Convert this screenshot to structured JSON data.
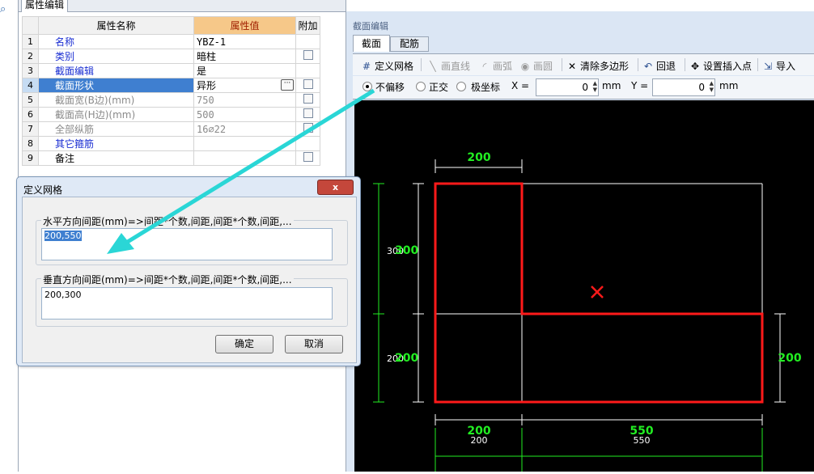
{
  "property_panel": {
    "tab": "属性编辑",
    "headers": {
      "name": "属性名称",
      "value": "属性值",
      "extra": "附加"
    },
    "rows": [
      {
        "idx": "1",
        "name": "名称",
        "value": "YBZ-1"
      },
      {
        "idx": "2",
        "name": "类别",
        "value": "暗柱"
      },
      {
        "idx": "3",
        "name": "截面编辑",
        "value": "是"
      },
      {
        "idx": "4",
        "name": "截面形状",
        "value": "异形",
        "button": "···"
      },
      {
        "idx": "5",
        "name": "截面宽(B边)(mm)",
        "value": "750"
      },
      {
        "idx": "6",
        "name": "截面高(H边)(mm)",
        "value": "500"
      },
      {
        "idx": "7",
        "name": "全部纵筋",
        "value": "16⌀22"
      },
      {
        "idx": "8",
        "name": "其它箍筋",
        "value": ""
      },
      {
        "idx": "9",
        "name": "备注",
        "value": ""
      }
    ]
  },
  "section_editor": {
    "title": "截面编辑",
    "tabs": [
      "截面",
      "配筋"
    ],
    "toolbar": {
      "define_grid": "定义网格",
      "draw_line": "画直线",
      "draw_arc": "画弧",
      "draw_circle": "画圆",
      "clear_polygon": "清除多边形",
      "undo": "回退",
      "set_insert_point": "设置插入点",
      "import": "导入"
    },
    "options": {
      "no_offset": "不偏移",
      "orthogonal": "正交",
      "polar": "极坐标",
      "x_label": "X =",
      "x_value": "0",
      "x_unit": "mm",
      "y_label": "Y =",
      "y_value": "0",
      "y_unit": "mm"
    },
    "canvas": {
      "dim_top": "200",
      "dim_left_upper": "300",
      "dim_left_upper_overlap": "300",
      "dim_left_lower": "200",
      "dim_left_lower_overlap": "200",
      "dim_right": "200",
      "dim_bottom_left": "200",
      "dim_bottom_left_small": "200",
      "dim_bottom_right": "550",
      "dim_bottom_right_small": "550",
      "colors": {
        "background": "#000000",
        "shape": "#ff1a1a",
        "dims": "#22ee22",
        "grid": "#ffffff",
        "arrow": "#2ad6d6"
      }
    }
  },
  "dialog": {
    "title": "定义网格",
    "close": "x",
    "horizontal_label": "水平方向间距(mm)=>间距*个数,间距,间距*个数,间距,...",
    "horizontal_value": "200,550",
    "vertical_label": "垂直方向间距(mm)=>间距*个数,间距,间距*个数,间距,...",
    "vertical_value": "200,300",
    "ok": "确定",
    "cancel": "取消"
  }
}
